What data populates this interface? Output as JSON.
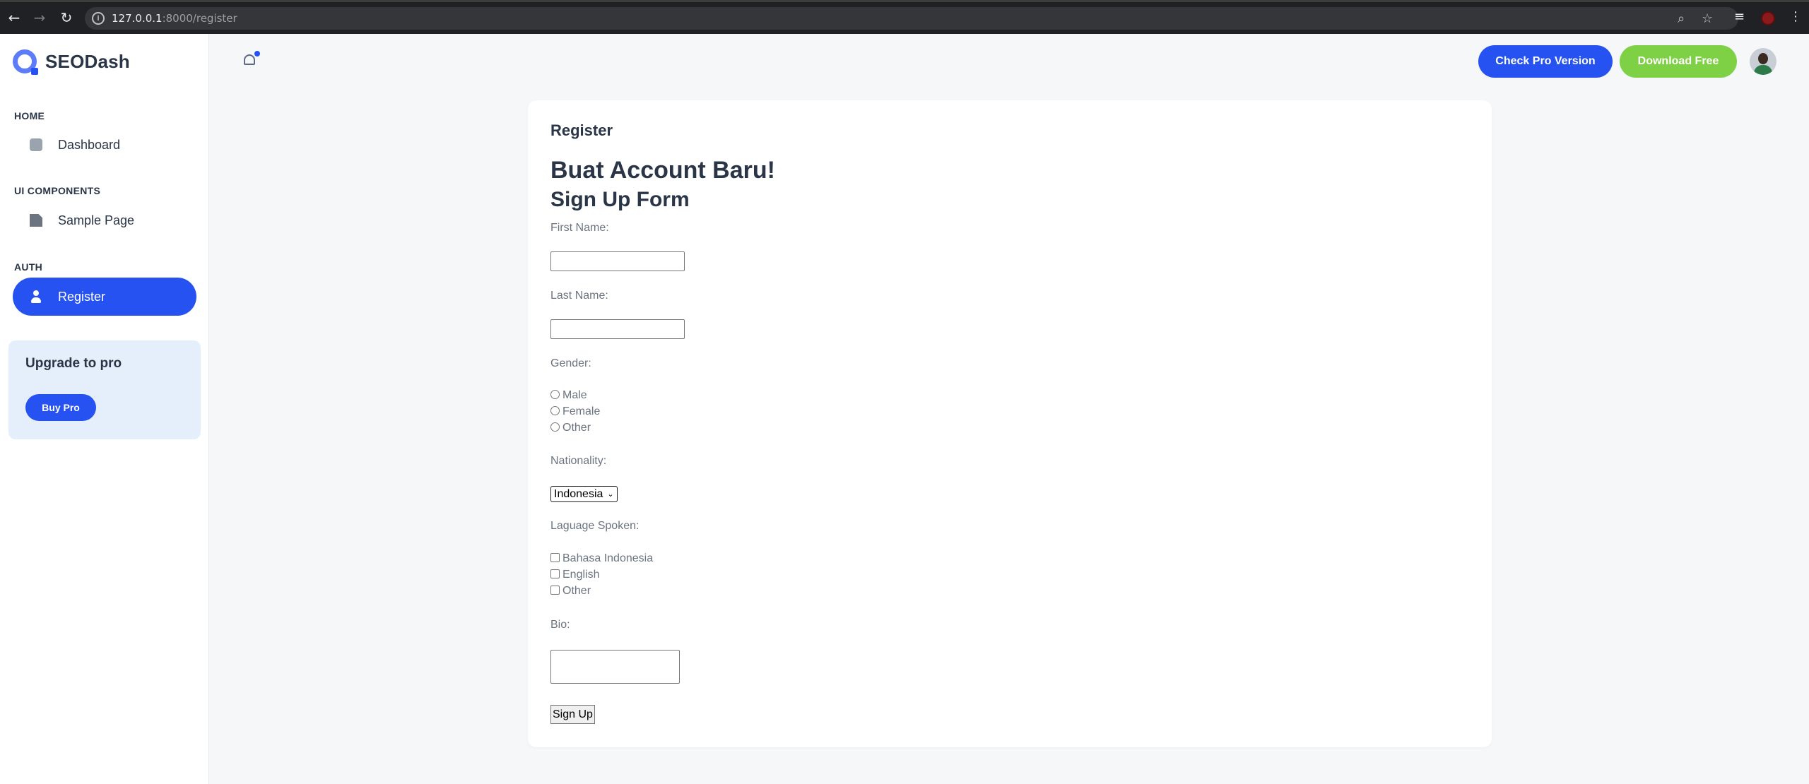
{
  "browser": {
    "url_host": "127.0.0.1",
    "url_rest": ":8000/register"
  },
  "sidebar": {
    "brand": "SEODash",
    "sections": [
      {
        "title": "HOME",
        "item": "Dashboard",
        "icon": "home-icon"
      },
      {
        "title": "UI COMPONENTS",
        "item": "Sample Page",
        "icon": "file-icon"
      },
      {
        "title": "AUTH",
        "item": "Register",
        "icon": "user-plus-icon"
      }
    ],
    "upgrade": {
      "title": "Upgrade to pro",
      "button": "Buy Pro"
    }
  },
  "header": {
    "pro_button": "Check Pro Version",
    "free_button": "Download Free"
  },
  "card": {
    "title": "Register",
    "heading": "Buat Account Baru!",
    "subheading": "Sign Up Form",
    "first_name_label": "First Name:",
    "last_name_label": "Last Name:",
    "gender_label": "Gender:",
    "gender_options": [
      "Male",
      "Female",
      "Other"
    ],
    "nationality_label": "Nationality:",
    "nationality_value": "Indonesia",
    "language_label": "Laguage Spoken:",
    "language_options": [
      "Bahasa Indonesia",
      "English",
      "Other"
    ],
    "bio_label": "Bio:",
    "submit": "Sign Up"
  },
  "colors": {
    "primary": "#2552f0",
    "success": "#7ed144",
    "text": "#2a3547"
  }
}
